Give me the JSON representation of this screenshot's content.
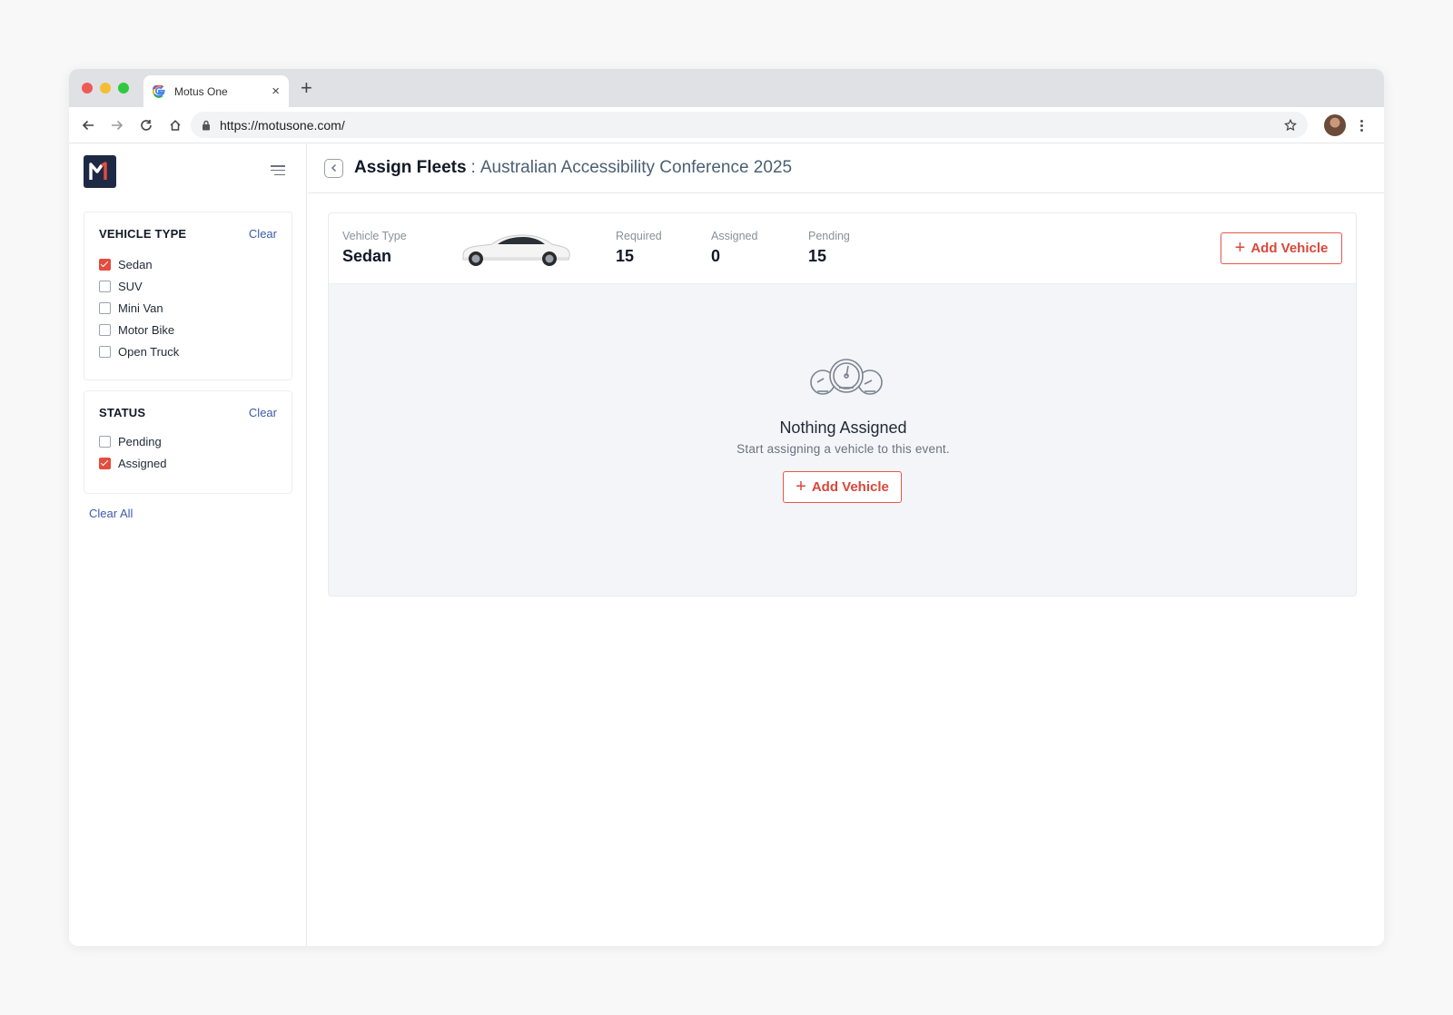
{
  "browser": {
    "tab_title": "Motus One",
    "tab_close": "×",
    "new_tab": "+",
    "url": "https://motusone.com/"
  },
  "sidebar": {
    "vehicle_type": {
      "title": "VEHICLE TYPE",
      "clear_label": "Clear",
      "options": [
        {
          "label": "Sedan",
          "checked": true
        },
        {
          "label": "SUV",
          "checked": false
        },
        {
          "label": "Mini Van",
          "checked": false
        },
        {
          "label": "Motor Bike",
          "checked": false
        },
        {
          "label": "Open Truck",
          "checked": false
        }
      ]
    },
    "status": {
      "title": "STATUS",
      "clear_label": "Clear",
      "options": [
        {
          "label": "Pending",
          "checked": false
        },
        {
          "label": "Assigned",
          "checked": true
        }
      ]
    },
    "clear_all_label": "Clear All"
  },
  "header": {
    "title": "Assign Fleets",
    "separator": ":",
    "event_name": "Australian Accessibility Conference 2025"
  },
  "summary": {
    "vehicle_type_label": "Vehicle Type",
    "vehicle_type_value": "Sedan",
    "required_label": "Required",
    "required_value": "15",
    "assigned_label": "Assigned",
    "assigned_value": "0",
    "pending_label": "Pending",
    "pending_value": "15",
    "add_vehicle_label": "Add Vehicle"
  },
  "empty_state": {
    "title": "Nothing Assigned",
    "subtitle": "Start assigning a vehicle to this event.",
    "add_vehicle_label": "Add Vehicle"
  },
  "colors": {
    "accent": "#e44c3e",
    "link": "#3b5ba9",
    "logo_bg": "#1e2a45"
  },
  "icons": {
    "plus": "+"
  }
}
